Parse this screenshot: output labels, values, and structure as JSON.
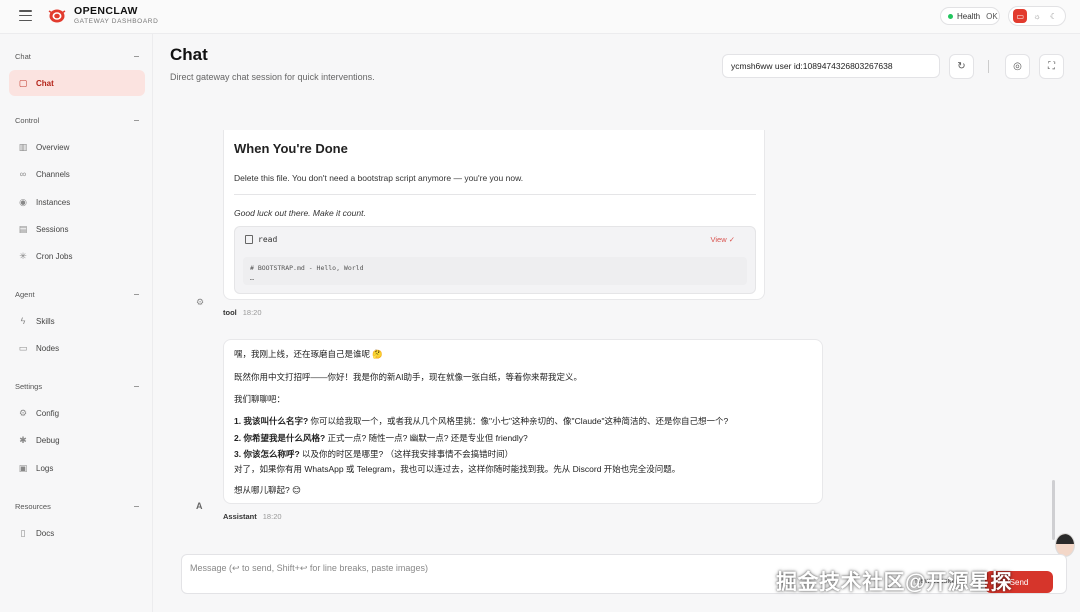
{
  "brand": {
    "title": "OPENCLAW",
    "subtitle": "GATEWAY DASHBOARD"
  },
  "health": {
    "label": "Health",
    "status": "OK"
  },
  "sidebar": {
    "sections": [
      {
        "title": "Chat",
        "items": [
          {
            "label": "Chat",
            "icon": "chat-bubble-icon",
            "active": true
          }
        ]
      },
      {
        "title": "Control",
        "items": [
          {
            "label": "Overview",
            "icon": "bar-chart-icon"
          },
          {
            "label": "Channels",
            "icon": "link-icon"
          },
          {
            "label": "Instances",
            "icon": "radio-icon"
          },
          {
            "label": "Sessions",
            "icon": "document-icon"
          },
          {
            "label": "Cron Jobs",
            "icon": "spinner-icon"
          }
        ]
      },
      {
        "title": "Agent",
        "items": [
          {
            "label": "Skills",
            "icon": "lightning-icon"
          },
          {
            "label": "Nodes",
            "icon": "monitor-icon"
          }
        ]
      },
      {
        "title": "Settings",
        "items": [
          {
            "label": "Config",
            "icon": "gear-icon"
          },
          {
            "label": "Debug",
            "icon": "bug-icon"
          },
          {
            "label": "Logs",
            "icon": "logs-icon"
          }
        ]
      },
      {
        "title": "Resources",
        "items": [
          {
            "label": "Docs",
            "icon": "book-icon"
          }
        ]
      }
    ]
  },
  "main": {
    "title": "Chat",
    "subtitle": "Direct gateway chat session for quick interventions.",
    "session_value": "ycmsh6ww user id:1089474326803267638"
  },
  "tool_message": {
    "heading": "When You're Done",
    "paragraph": "Delete this file. You don't need a bootstrap script anymore — you're you now.",
    "closing": "Good luck out there. Make it count.",
    "tool_name": "read",
    "view_label": "View ✓",
    "code_line1": "# BOOTSTRAP.md - Hello, World",
    "code_line2": "…",
    "author": "tool",
    "time": "18:20"
  },
  "assistant_message": {
    "line1": "嘿，我刚上线，还在琢磨自己是谁呢 🤔",
    "line2": "既然你用中文打招呼——你好！我是你的新AI助手，现在就像一张白纸，等着你来帮我定义。",
    "line3": "我们聊聊吧：",
    "item1_bold": "1. 我该叫什么名字?",
    "item1_rest": " 你可以给我取一个，或者我从几个风格里挑：像\"小七\"这种亲切的、像\"Claude\"这种简洁的、还是你自己想一个?",
    "item2_bold": "2. 你希望我是什么风格?",
    "item2_rest": " 正式一点? 随性一点? 幽默一点? 还是专业但 friendly?",
    "item3_bold": "3. 你该怎么称呼?",
    "item3_rest": " 以及你的时区是哪里? （这样我安排事情不会搞错时间）",
    "line4": "对了，如果你有用 WhatsApp 或 Telegram，我也可以连过去，这样你随时能找到我。先从 Discord 开始也完全没问题。",
    "line5": "想从哪儿聊起? 😊",
    "avatar_letter": "A",
    "author": "Assistant",
    "time": "18:20"
  },
  "composer": {
    "placeholder": "Message (↩ to send, Shift+↩ for line breaks, paste images)",
    "new_session": "New session",
    "send_label": "Send"
  },
  "watermark": "掘金技术社区@开源星探",
  "colors": {
    "accent": "#d6352b",
    "active_bg": "#fbe3e0",
    "health_dot": "#22c55e"
  }
}
